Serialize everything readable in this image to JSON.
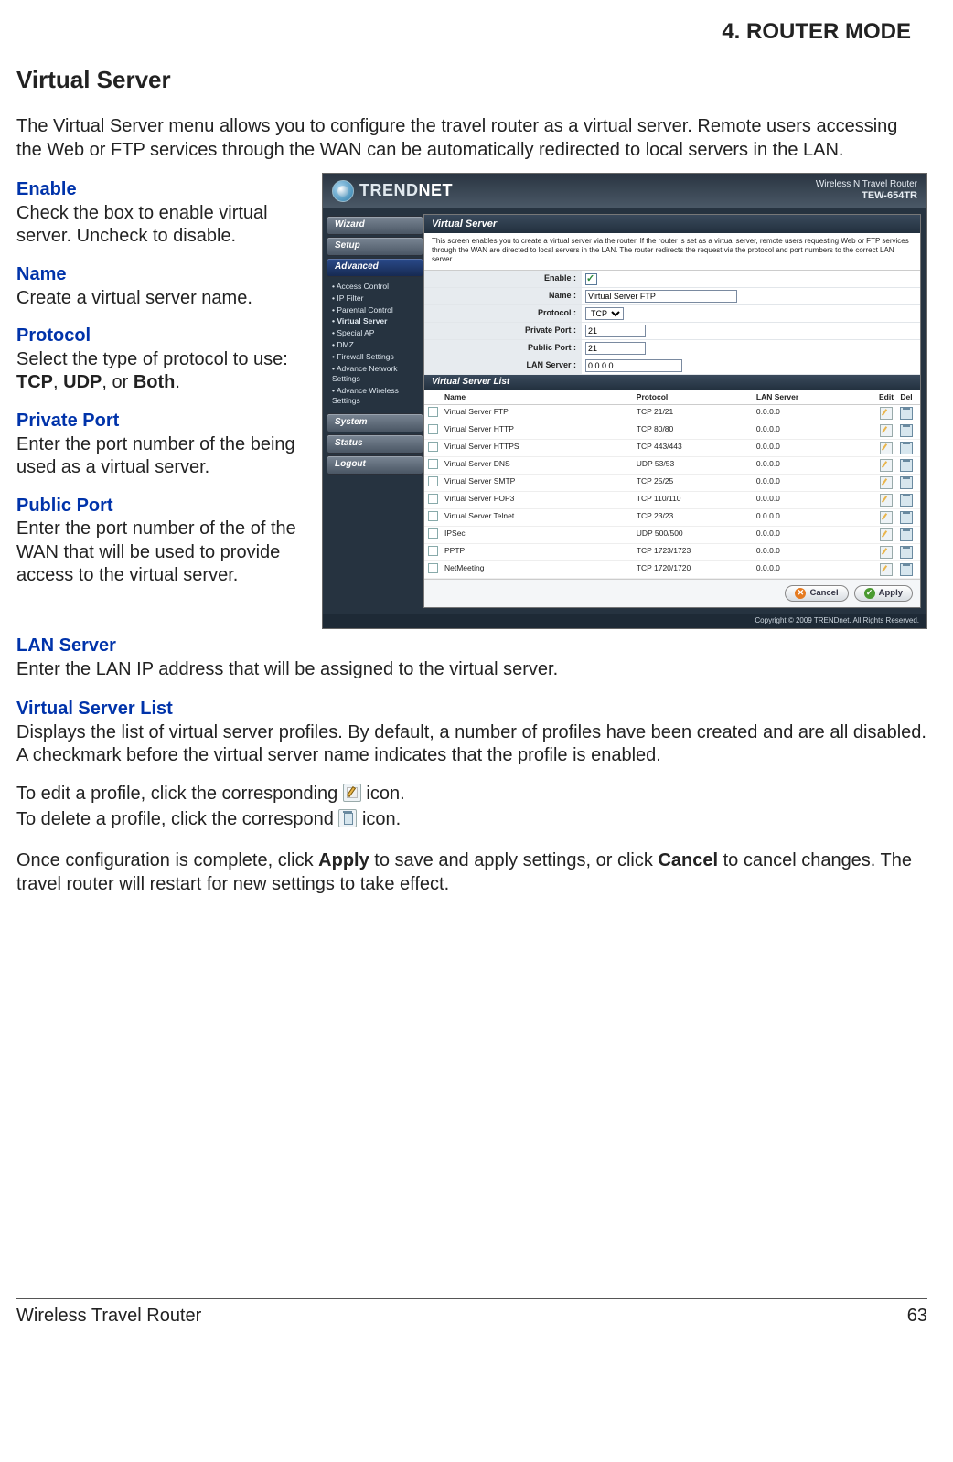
{
  "chapter": "4.  ROUTER MODE",
  "title": "Virtual Server",
  "intro": "The Virtual Server menu allows you to configure the travel router as a virtual server. Remote users accessing the Web or FTP services through the WAN can be automatically redirected to local servers in the LAN.",
  "fields": {
    "enable": {
      "label": "Enable",
      "desc": "Check the box to enable virtual server. Uncheck to disable."
    },
    "name": {
      "label": "Name",
      "desc": "Create a virtual server name."
    },
    "protocol": {
      "label": "Protocol",
      "desc_before": "Select the type of protocol to use: ",
      "opt1": "TCP",
      "comma1": ", ",
      "opt2": "UDP",
      "comma2": ", or ",
      "opt3": "Both",
      "period": "."
    },
    "privatePort": {
      "label": "Private Port",
      "desc": "Enter the port number of the being used as a virtual server."
    },
    "publicPort": {
      "label": "Public Port",
      "desc": "Enter the port number of the of the WAN that will be used to provide access to the virtual server."
    },
    "lanServer": {
      "label": "LAN Server",
      "desc": "Enter the LAN IP address that will be assigned to the virtual server."
    },
    "vsList": {
      "label": "Virtual Server List",
      "desc": "Displays the list of virtual server profiles. By default, a number of profiles have been created and are all disabled. A checkmark before the virtual server name indicates that the profile is enabled."
    }
  },
  "editLine": {
    "before": "To edit a profile, click the corresponding ",
    "after": " icon."
  },
  "deleteLine": {
    "before": "To delete a profile, click the correspond ",
    "after": " icon."
  },
  "finalPara": {
    "t1": "Once configuration is complete, click ",
    "apply": "Apply",
    "t2": " to save and apply settings, or click ",
    "cancel": "Cancel",
    "t3": " to cancel changes. The travel router will restart for new settings to take effect."
  },
  "footer": {
    "left": "Wireless Travel Router",
    "right": "63"
  },
  "ui": {
    "brand_plain": "TREND",
    "brand_bold": "NET",
    "model_line1": "Wireless N Travel Router",
    "model_line2": "TEW-654TR",
    "side": {
      "wizard": "Wizard",
      "setup": "Setup",
      "advanced": "Advanced",
      "system": "System",
      "status": "Status",
      "logout": "Logout",
      "adv_items": [
        "Access Control",
        "IP Filter",
        "Parental Control",
        "Virtual Server",
        "Special AP",
        "DMZ",
        "Firewall Settings",
        "Advance Network Settings",
        "Advance Wireless Settings"
      ]
    },
    "pane_title": "Virtual Server",
    "pane_desc": "This screen enables you to create a virtual server via the router. If the router is set as a virtual server, remote users requesting Web or FTP services through the WAN are directed to local servers in the LAN. The router redirects the request via the protocol and port numbers to the correct LAN server.",
    "form": {
      "enable": {
        "lbl": "Enable :",
        "checked": true
      },
      "name": {
        "lbl": "Name :",
        "val": "Virtual Server FTP"
      },
      "protocol": {
        "lbl": "Protocol :",
        "val": "TCP"
      },
      "privatePort": {
        "lbl": "Private Port :",
        "val": "21"
      },
      "publicPort": {
        "lbl": "Public Port :",
        "val": "21"
      },
      "lanServer": {
        "lbl": "LAN Server :",
        "val": "0.0.0.0"
      }
    },
    "list_title": "Virtual Server List",
    "list_head": {
      "name": "Name",
      "proto": "Protocol",
      "lan": "LAN Server",
      "edit": "Edit",
      "del": "Del"
    },
    "list_rows": [
      {
        "name": "Virtual Server FTP",
        "proto": "TCP 21/21",
        "lan": "0.0.0.0"
      },
      {
        "name": "Virtual Server HTTP",
        "proto": "TCP 80/80",
        "lan": "0.0.0.0"
      },
      {
        "name": "Virtual Server HTTPS",
        "proto": "TCP 443/443",
        "lan": "0.0.0.0"
      },
      {
        "name": "Virtual Server DNS",
        "proto": "UDP 53/53",
        "lan": "0.0.0.0"
      },
      {
        "name": "Virtual Server SMTP",
        "proto": "TCP 25/25",
        "lan": "0.0.0.0"
      },
      {
        "name": "Virtual Server POP3",
        "proto": "TCP 110/110",
        "lan": "0.0.0.0"
      },
      {
        "name": "Virtual Server Telnet",
        "proto": "TCP 23/23",
        "lan": "0.0.0.0"
      },
      {
        "name": "IPSec",
        "proto": "UDP 500/500",
        "lan": "0.0.0.0"
      },
      {
        "name": "PPTP",
        "proto": "TCP 1723/1723",
        "lan": "0.0.0.0"
      },
      {
        "name": "NetMeeting",
        "proto": "TCP 1720/1720",
        "lan": "0.0.0.0"
      }
    ],
    "buttons": {
      "cancel": "Cancel",
      "apply": "Apply"
    },
    "copyright": "Copyright © 2009 TRENDnet. All Rights Reserved."
  }
}
